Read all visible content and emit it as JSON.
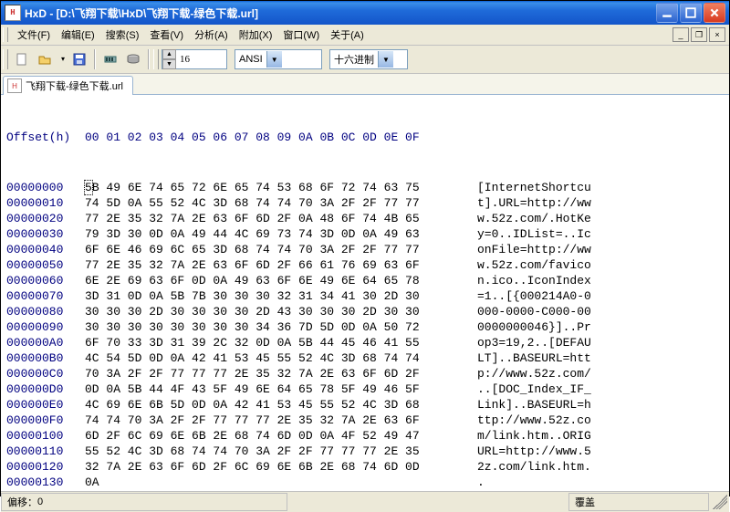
{
  "window": {
    "title": "HxD - [D:\\飞翔下载\\HxD\\飞翔下载-绿色下载.url]"
  },
  "menus": {
    "file": "文件(F)",
    "edit": "编辑(E)",
    "search": "搜索(S)",
    "view": "查看(V)",
    "analyze": "分析(A)",
    "extras": "附加(X)",
    "window": "窗口(W)",
    "help": "关于(A)"
  },
  "toolbar": {
    "group_size": "16",
    "encoding": "ANSI",
    "base": "十六进制"
  },
  "tab": {
    "label": "飞翔下载-绿色下载.url"
  },
  "hex": {
    "offset_header": "Offset(h)",
    "col_header": "00 01 02 03 04 05 06 07 08 09 0A 0B 0C 0D 0E 0F",
    "rows": [
      {
        "o": "00000000",
        "h": "5B 49 6E 74 65 72 6E 65 74 53 68 6F 72 74 63 75",
        "a": "[InternetShortcu"
      },
      {
        "o": "00000010",
        "h": "74 5D 0A 55 52 4C 3D 68 74 74 70 3A 2F 2F 77 77",
        "a": "t].URL=http://ww"
      },
      {
        "o": "00000020",
        "h": "77 2E 35 32 7A 2E 63 6F 6D 2F 0A 48 6F 74 4B 65",
        "a": "w.52z.com/.HotKe"
      },
      {
        "o": "00000030",
        "h": "79 3D 30 0D 0A 49 44 4C 69 73 74 3D 0D 0A 49 63",
        "a": "y=0..IDList=..Ic"
      },
      {
        "o": "00000040",
        "h": "6F 6E 46 69 6C 65 3D 68 74 74 70 3A 2F 2F 77 77",
        "a": "onFile=http://ww"
      },
      {
        "o": "00000050",
        "h": "77 2E 35 32 7A 2E 63 6F 6D 2F 66 61 76 69 63 6F",
        "a": "w.52z.com/favico"
      },
      {
        "o": "00000060",
        "h": "6E 2E 69 63 6F 0D 0A 49 63 6F 6E 49 6E 64 65 78",
        "a": "n.ico..IconIndex"
      },
      {
        "o": "00000070",
        "h": "3D 31 0D 0A 5B 7B 30 30 30 32 31 34 41 30 2D 30",
        "a": "=1..[{000214A0-0"
      },
      {
        "o": "00000080",
        "h": "30 30 30 2D 30 30 30 30 2D 43 30 30 30 2D 30 30",
        "a": "000-0000-C000-00"
      },
      {
        "o": "00000090",
        "h": "30 30 30 30 30 30 30 30 34 36 7D 5D 0D 0A 50 72",
        "a": "0000000046}]..Pr"
      },
      {
        "o": "000000A0",
        "h": "6F 70 33 3D 31 39 2C 32 0D 0A 5B 44 45 46 41 55",
        "a": "op3=19,2..[DEFAU"
      },
      {
        "o": "000000B0",
        "h": "4C 54 5D 0D 0A 42 41 53 45 55 52 4C 3D 68 74 74",
        "a": "LT]..BASEURL=htt"
      },
      {
        "o": "000000C0",
        "h": "70 3A 2F 2F 77 77 77 2E 35 32 7A 2E 63 6F 6D 2F",
        "a": "p://www.52z.com/"
      },
      {
        "o": "000000D0",
        "h": "0D 0A 5B 44 4F 43 5F 49 6E 64 65 78 5F 49 46 5F",
        "a": "..[DOC_Index_IF_"
      },
      {
        "o": "000000E0",
        "h": "4C 69 6E 6B 5D 0D 0A 42 41 53 45 55 52 4C 3D 68",
        "a": "Link]..BASEURL=h"
      },
      {
        "o": "000000F0",
        "h": "74 74 70 3A 2F 2F 77 77 77 2E 35 32 7A 2E 63 6F",
        "a": "ttp://www.52z.co"
      },
      {
        "o": "00000100",
        "h": "6D 2F 6C 69 6E 6B 2E 68 74 6D 0D 0A 4F 52 49 47",
        "a": "m/link.htm..ORIG"
      },
      {
        "o": "00000110",
        "h": "55 52 4C 3D 68 74 74 70 3A 2F 2F 77 77 77 2E 35",
        "a": "URL=http://www.5"
      },
      {
        "o": "00000120",
        "h": "32 7A 2E 63 6F 6D 2F 6C 69 6E 6B 2E 68 74 6D 0D",
        "a": "2z.com/link.htm."
      },
      {
        "o": "00000130",
        "h": "0A                                             ",
        "a": "."
      }
    ]
  },
  "status": {
    "offset_label": "偏移：",
    "offset_value": "0",
    "overwrite": "覆盖"
  }
}
